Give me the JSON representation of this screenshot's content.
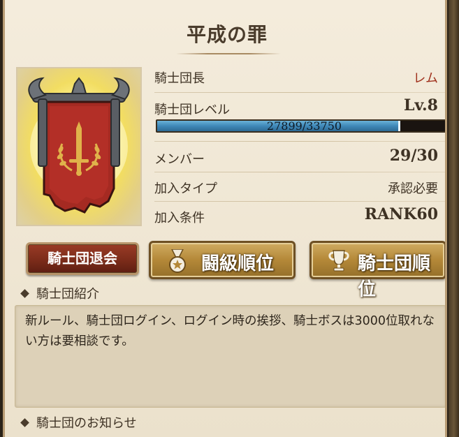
{
  "guild": {
    "name": "平成の罪"
  },
  "info": {
    "leader_label": "騎士団長",
    "leader_value": "レム",
    "level_label": "騎士団レベル",
    "level_value": "Lv.8",
    "xp_text": "27899/33750",
    "xp_current": 27899,
    "xp_max": 33750,
    "members_label": "メンバー",
    "members_value": "29/30",
    "join_type_label": "加入タイプ",
    "join_type_value": "承認必要",
    "join_cond_label": "加入条件",
    "join_cond_value": "RANK60"
  },
  "buttons": {
    "leave": "騎士団退会",
    "ranking": "闘級順位",
    "guild_ranking": "騎士団順位"
  },
  "sections": {
    "intro_title": "騎士団紹介",
    "intro_text": "新ルール、騎士団ログイン、ログイン時の挨拶、騎士ボスは3000位取れない方は要相談です。",
    "news_title": "騎士団のお知らせ"
  },
  "icons": {
    "emblem": "guild-banner-sword-laurel",
    "ranking": "medal-star-icon",
    "guild_ranking": "trophy-icon"
  },
  "colors": {
    "panel_bg": "#efe6d3",
    "xp_fill": "#3f88b8",
    "leave_button": "#7c2c1a",
    "gold_button": "#b48838",
    "leader_name": "#a0321e"
  }
}
